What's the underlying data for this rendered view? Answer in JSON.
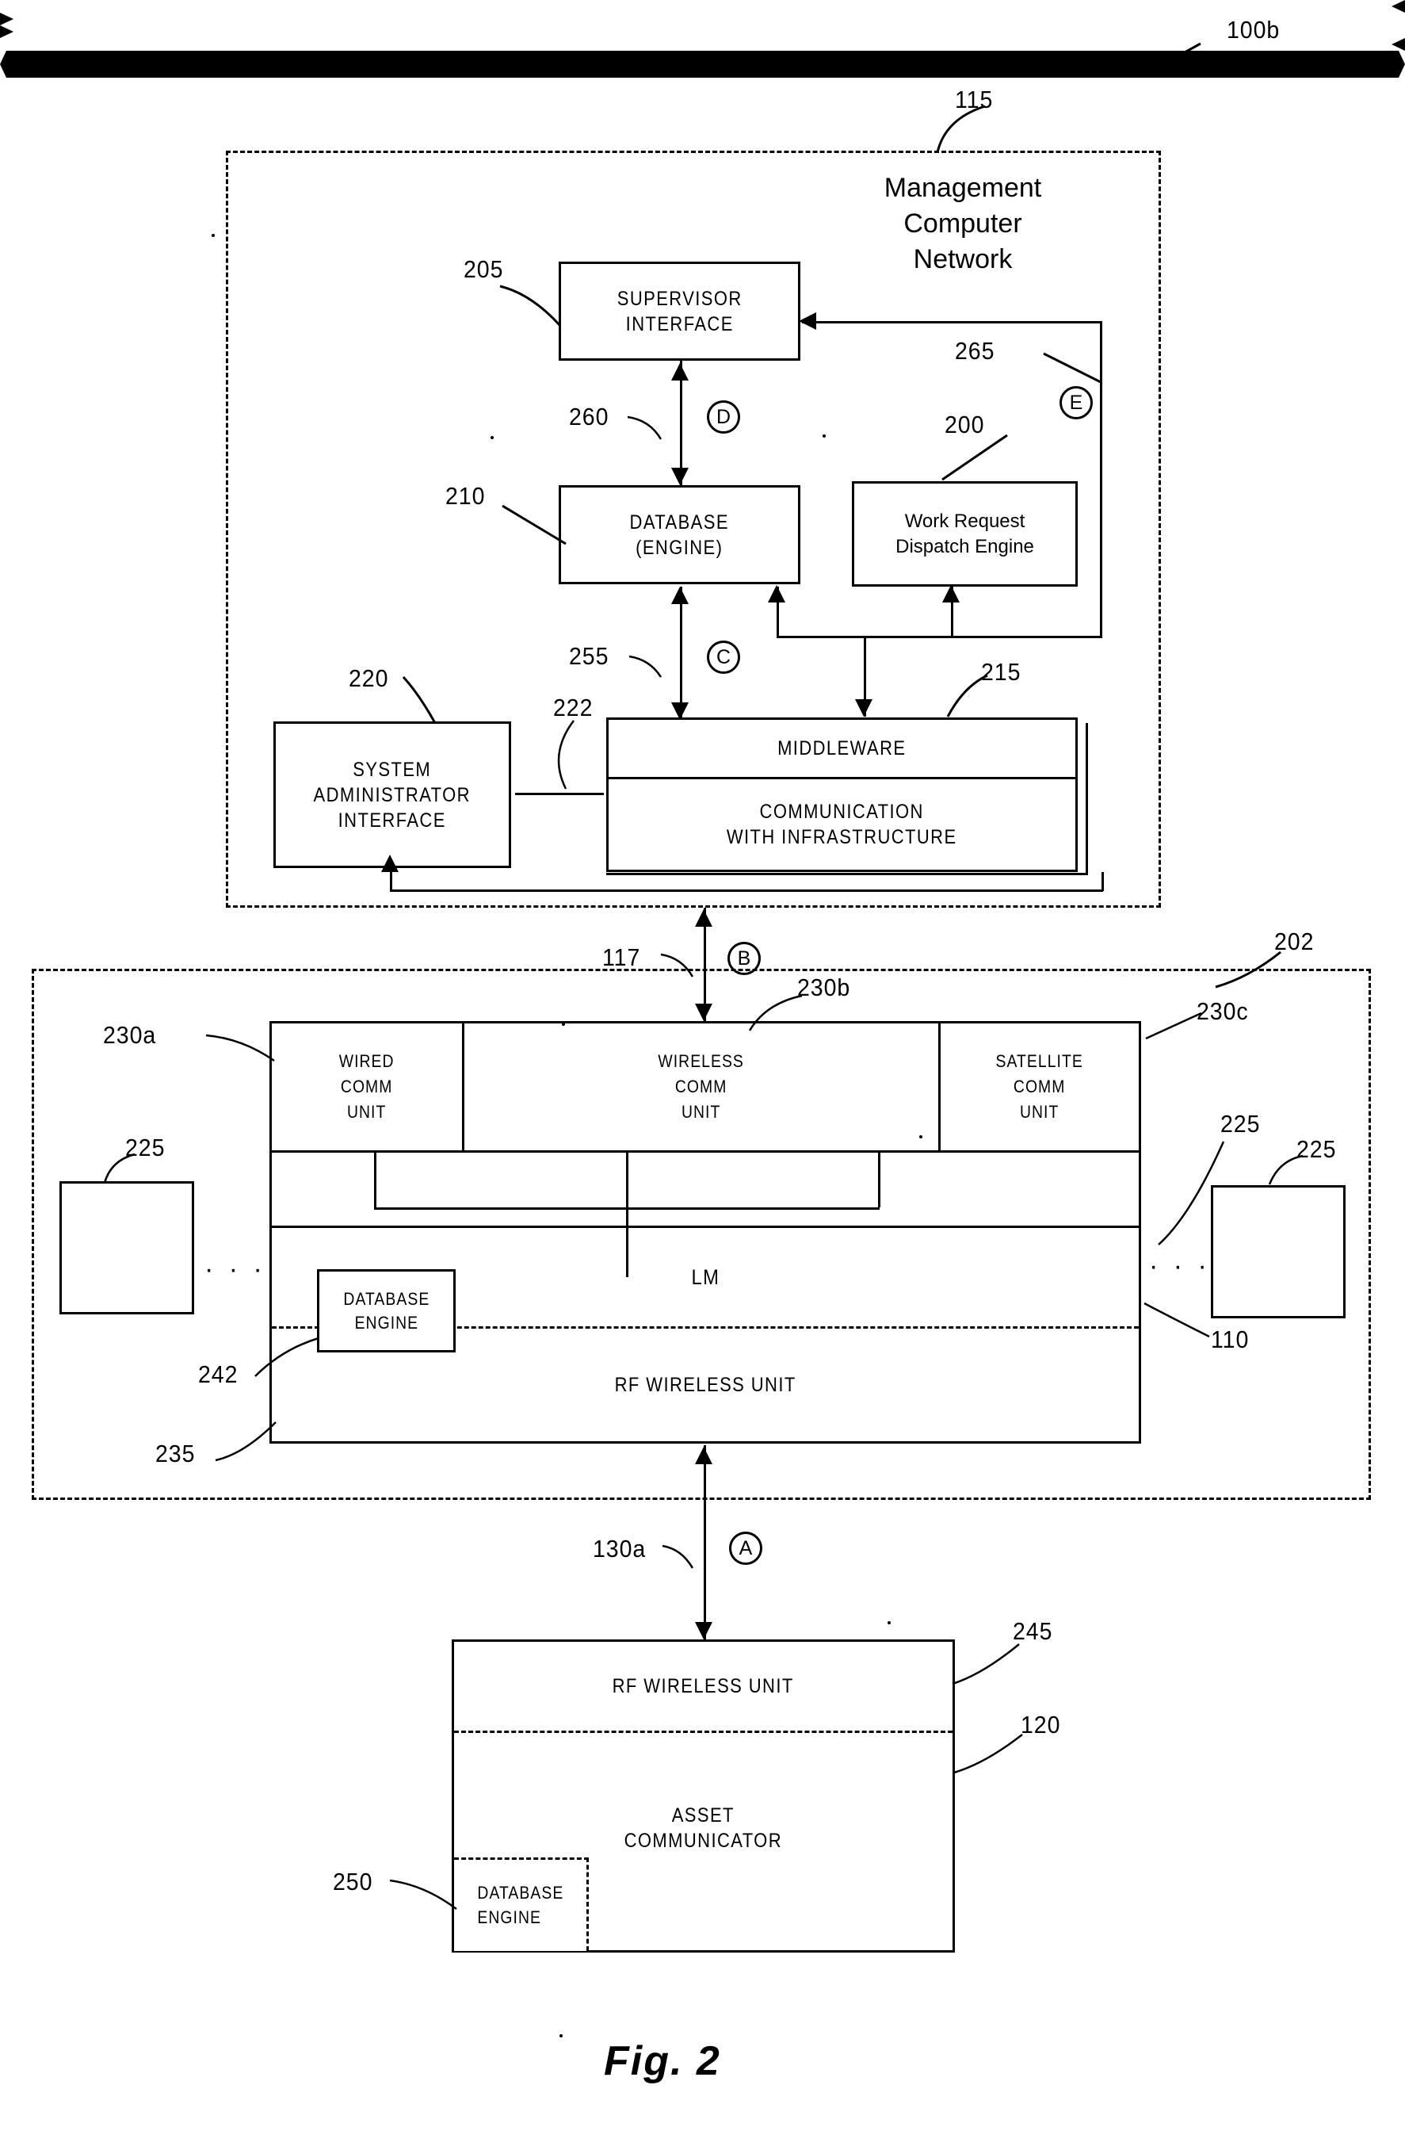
{
  "figure": {
    "caption": "Fig. 2",
    "system_ref": "100b"
  },
  "management_network": {
    "ref": "115",
    "title": "Management\nComputer\nNetwork",
    "blocks": {
      "supervisor_interface": {
        "ref": "205",
        "label": "SUPERVISOR\nINTERFACE"
      },
      "database_engine": {
        "ref": "210",
        "label": "DATABASE\n(ENGINE)"
      },
      "work_request_dispatch_engine": {
        "ref": "200",
        "label": "Work Request\nDispatch Engine"
      },
      "system_administrator_interface": {
        "ref": "220",
        "label": "SYSTEM\nADMINISTRATOR\nINTERFACE"
      },
      "middleware": {
        "ref": "215",
        "label_top": "MIDDLEWARE",
        "label_bottom": "COMMUNICATION\nWITH INFRASTRUCTURE"
      }
    },
    "connectors": {
      "supervisor_to_database": {
        "ref": "260",
        "tag": "D"
      },
      "database_to_middleware": {
        "ref": "255",
        "tag": "C"
      },
      "admin_to_middleware": {
        "ref": "222"
      },
      "dispatch_return_path": {
        "ref": "265",
        "tag": "E"
      }
    }
  },
  "link_115_to_202": {
    "ref": "117",
    "tag": "B"
  },
  "infrastructure": {
    "ref": "202",
    "lm_unit_ref": "110",
    "comm_units": [
      {
        "ref": "230a",
        "label": "WIRED\nCOMM\nUNIT"
      },
      {
        "ref": "230b",
        "label": "WIRELESS\nCOMM\nUNIT"
      },
      {
        "ref": "230c",
        "label": "SATELLITE\nCOMM\nUNIT"
      }
    ],
    "lm": {
      "label": "LM"
    },
    "database_engine": {
      "ref": "242",
      "label": "DATABASE\nENGINE"
    },
    "rf_wireless_unit": {
      "ref": "235",
      "label": "RF  WIRELESS  UNIT"
    },
    "peers": [
      {
        "ref": "225",
        "position": "left"
      },
      {
        "ref": "225",
        "position": "right-inner"
      },
      {
        "ref": "225",
        "position": "right-outer"
      }
    ],
    "ellipsis": "· · ·"
  },
  "link_202_to_asset": {
    "ref": "130a",
    "tag": "A"
  },
  "asset": {
    "ref": "120",
    "rf_wireless_unit": {
      "ref": "245",
      "label": "RF  WIRELESS  UNIT"
    },
    "asset_communicator": {
      "label": "ASSET\nCOMMUNICATOR"
    },
    "database_engine": {
      "ref": "250",
      "label": "DATABASE\nENGINE"
    }
  }
}
